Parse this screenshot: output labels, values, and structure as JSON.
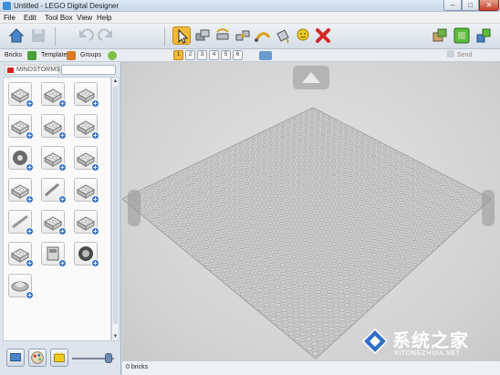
{
  "window": {
    "title": "Untitled - LEGO Digital Designer",
    "min": "–",
    "max": "□",
    "close": "✕"
  },
  "menu": [
    "File",
    "Edit",
    "Tool Box",
    "View",
    "Help"
  ],
  "toolbar": {
    "left_icons": [
      "home-icon",
      "save-icon",
      "undo-icon",
      "redo-icon"
    ],
    "tools": [
      "select-tool-icon",
      "clone-tool-icon",
      "hinge-tool-icon",
      "hinge-align-tool-icon",
      "flex-tool-icon",
      "paint-tool-icon",
      "minifig-tool-icon",
      "delete-tool-icon"
    ],
    "right_icons": [
      "build-mode-icon",
      "view-mode-icon",
      "building-guide-icon"
    ],
    "colors": {
      "active": "#f3b93a",
      "delete": "#d12a22"
    }
  },
  "subbar": {
    "tabs": [
      "Bricks",
      "Templates",
      "Groups"
    ],
    "modes": [
      "1",
      "2",
      "3",
      "4",
      "5",
      "6"
    ],
    "send_label": "Send"
  },
  "palette": {
    "brand": "MINDSTORMS",
    "search_placeholder": "",
    "bricks": [
      "brick-2x4",
      "brick-1x4",
      "brick-1x6",
      "plate-2x2",
      "plate-2x4",
      "plate-round",
      "gear",
      "axle-joint",
      "beam-bent",
      "connector-peg",
      "axle",
      "beam-holes",
      "axle-long",
      "pin-connector",
      "beam-angle",
      "motor",
      "nxt-brick",
      "tire",
      "dish"
    ]
  },
  "status": {
    "bricks_count": "0 bricks"
  },
  "watermark": {
    "main": "系统之家",
    "sub": "XITONGZHIJIA.NET"
  }
}
